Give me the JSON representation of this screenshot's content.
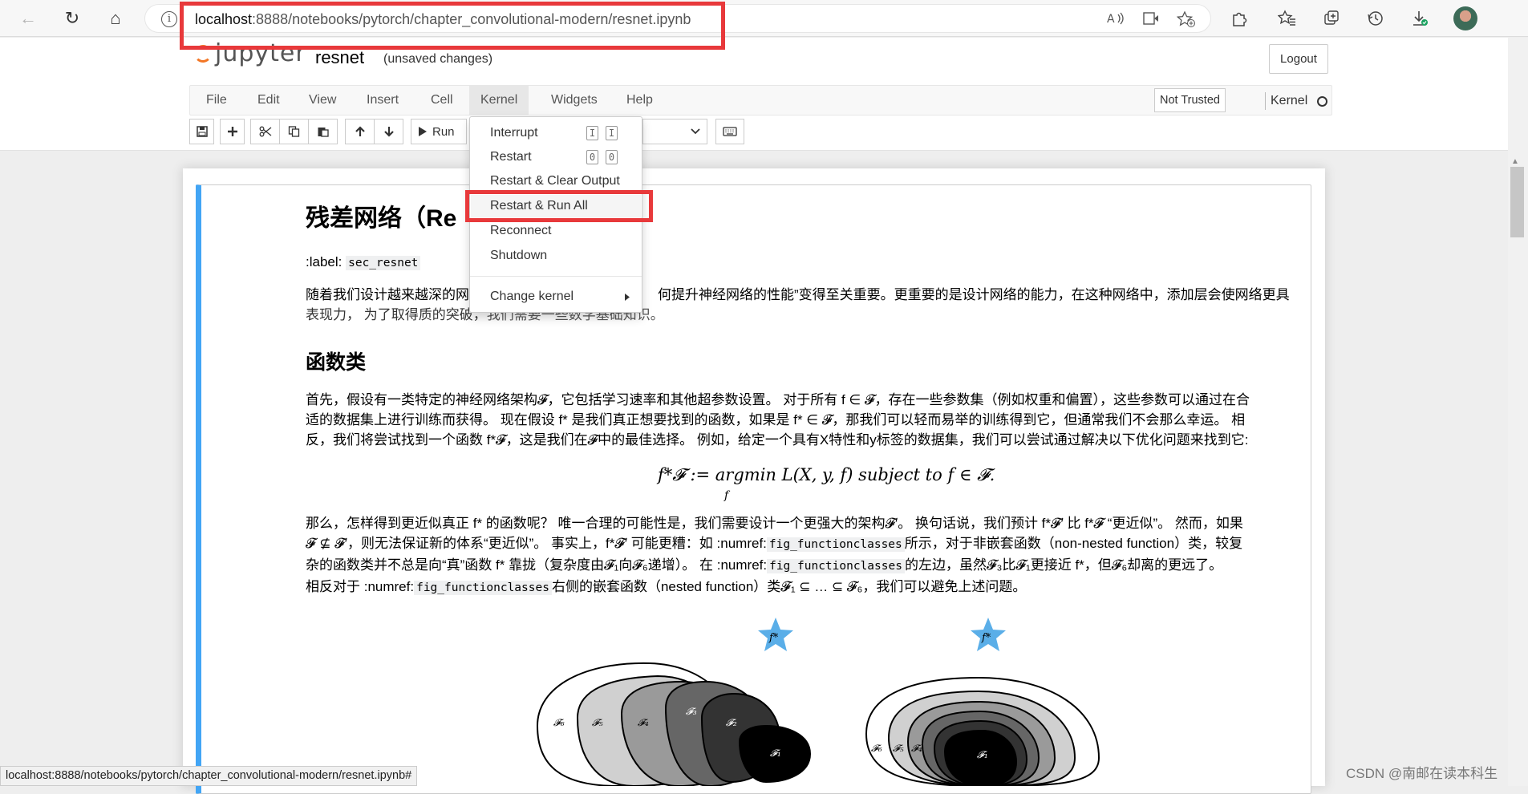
{
  "browser": {
    "url_host": "localhost",
    "url_rest": ":8888/notebooks/pytorch/chapter_convolutional-modern/resnet.ipynb",
    "back_glyph": "←",
    "refresh_glyph": "↻",
    "home_glyph": "⌂",
    "info_glyph": "i",
    "status_url": "localhost:8888/notebooks/pytorch/chapter_convolutional-modern/resnet.ipynb#",
    "icons": [
      "read-aloud-icon",
      "immersive-reader-icon",
      "add-favorite-icon",
      "extensions-icon",
      "favorites-icon",
      "collections-icon",
      "history-icon",
      "downloads-icon",
      "profile-avatar"
    ]
  },
  "jupyter": {
    "logo_text": "jupyter",
    "notebook_name": "resnet",
    "save_status": "(unsaved changes)",
    "logout_label": "Logout",
    "menus": [
      "File",
      "Edit",
      "View",
      "Insert",
      "Cell",
      "Kernel",
      "Widgets",
      "Help"
    ],
    "active_menu": "Kernel",
    "not_trusted_label": "Not Trusted",
    "kernel_label": "Kernel",
    "run_label": "Run"
  },
  "kernel_menu": {
    "items": [
      "Interrupt",
      "Restart",
      "Restart & Clear Output",
      "Restart & Run All",
      "Reconnect",
      "Shutdown"
    ],
    "interrupt_keys": [
      "I",
      "I"
    ],
    "restart_keys": [
      "0",
      "0"
    ],
    "change_kernel": "Change kernel",
    "highlighted": "Restart & Run All"
  },
  "notebook": {
    "h1": "残差网络（Re",
    "label_prefix": ":label:",
    "label_code": "sec_resnet",
    "p1_left": "随着我们设计越来越深的网",
    "p1_right": "何提升神经网络的性能”变得至关重要。更重要的是设计网络的能力，在这种网络中，添加层会使网络更具",
    "p1_line2_left": "表现力，  为了取得质的突破，",
    "p1_line2_right": "我们需要一些数学基础知识。",
    "h2": "函数类",
    "p2_line1": "首先，假设有一类特定的神经网络架构𝓕，它包括学习速率和其他超参数设置。 对于所有 f ∈ 𝓕，存在一些参数集（例如权重和偏置），这些参数可以通过在合",
    "p2_line2": "适的数据集上进行训练而获得。 现在假设 f* 是我们真正想要找到的函数，如果是 f* ∈ 𝓕，那我们可以轻而易举的训练得到它，但通常我们不会那么幸运。 相",
    "p2_line3": "反，我们将尝试找到一个函数 f*𝓕，这是我们在𝓕中的最佳选择。 例如，给定一个具有X特性和y标签的数据集，我们可以尝试通过解决以下优化问题来找到它:",
    "equation": "f*𝓕 := argmin L(X, y, f) subject to f ∈ 𝓕.",
    "equation_sub": "f",
    "p3_line1": "那么，怎样得到更近似真正 f* 的函数呢？ 唯一合理的可能性是，我们需要设计一个更强大的架构𝓕′。 换句话说，我们预计 f*𝓕′ 比 f*𝓕 “更近似”。 然而，如果",
    "p3_line2a": "𝓕 ⊈ 𝓕′，则无法保证新的体系“更近似”。 事实上，f*𝓕′ 可能更糟：如 :numref:",
    "p3_code": "fig_functionclasses",
    "p3_line2b": "所示，对于非嵌套函数（non-nested function）类，较复",
    "p3_line3a": "杂的函数类并不总是向“真”函数 f* 靠拢（复杂度由𝓕₁向𝓕₆递增）。 在 :numref:",
    "p3_line3b": "的左边，虽然𝓕₃比𝓕₁更接近 f*，但𝓕₆却离的更远了。",
    "p3_line4a": "相反对于 :numref:",
    "p3_line4b": "右侧的嵌套函数（nested function）类𝓕₁ ⊆ … ⊆ 𝓕₆，我们可以避免上述问题。"
  },
  "figure": {
    "star_label": "f*",
    "left_labels": [
      "𝓕₆",
      "𝓕₅",
      "𝓕₄",
      "𝓕₃",
      "𝓕₂",
      "𝓕₁"
    ],
    "right_labels": [
      "𝓕₆",
      "𝓕₅",
      "𝓕₄",
      "𝓕₁"
    ]
  },
  "watermark": "CSDN @南邮在读本科生",
  "colors": {
    "highlight_red": "#e8393b",
    "cell_selected_blue": "#42a5f5",
    "jupyter_orange": "#f37726",
    "star_blue": "#5aaee8"
  }
}
